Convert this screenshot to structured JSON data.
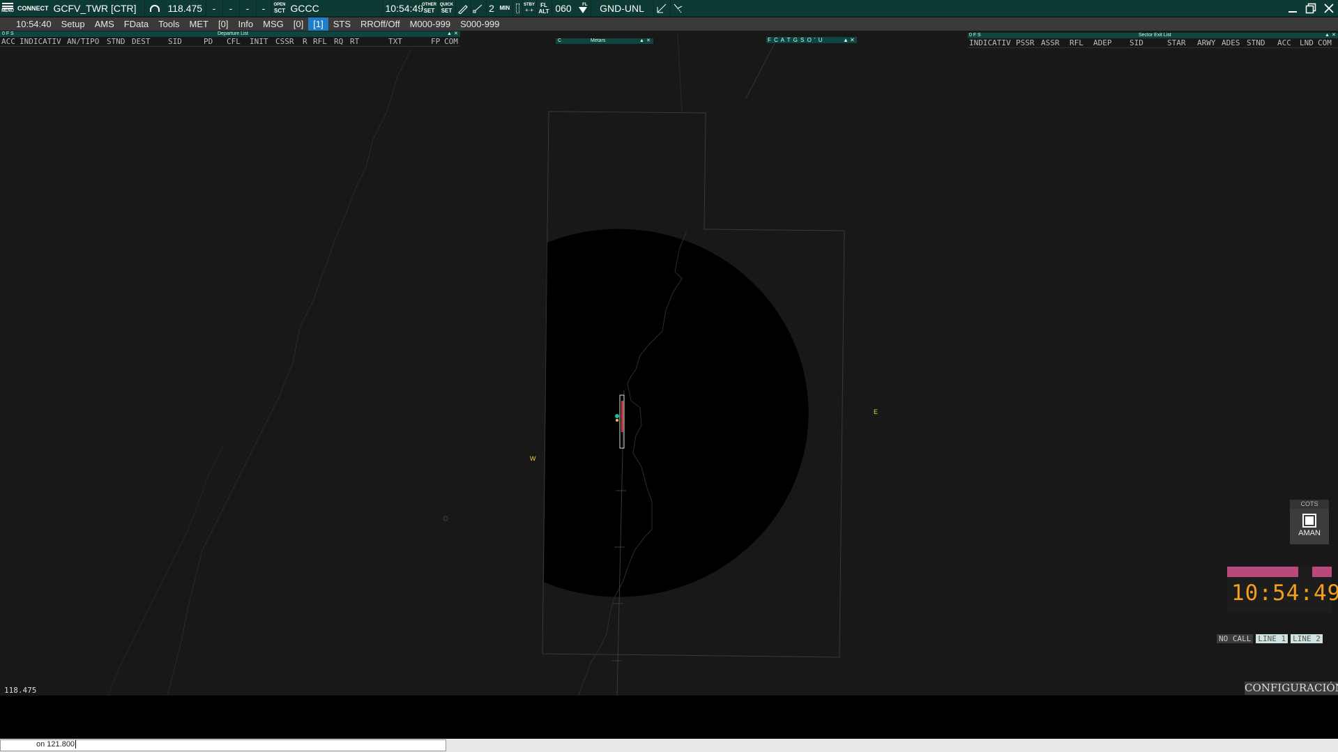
{
  "topbar": {
    "menu": "MENU",
    "connect": "CONNECT",
    "callsign": "GCFV_TWR [CTR]",
    "frequency": "118.475",
    "dash1": "-",
    "dash2": "-",
    "dash3": "-",
    "dash4": "-",
    "open_sct_1": "OPEN",
    "open_sct_2": "SCT",
    "sector": "GCCC",
    "time": "10:54:49",
    "other_set_1": "OTHER",
    "other_set_2": "SET",
    "quick_set_1": "QUICK",
    "quick_set_2": "SET",
    "min_value": "2",
    "min_label": "MIN",
    "stby_1": "STBY",
    "stby_2": "",
    "fl_1": "FL",
    "fl_2": "ALT",
    "alt_value": "060",
    "fl_toggle": "FL",
    "filter": "GND-UNL"
  },
  "menubar": {
    "time": "10:54:40",
    "setup": "Setup",
    "ams": "AMS",
    "fdata": "FData",
    "tools": "Tools",
    "met": "MET",
    "met_count": "[0]",
    "info": "Info",
    "msg": "MSG",
    "msg_count": "[0]",
    "active_count": "[1]",
    "sts": "STS",
    "rroff": "RROff/Off",
    "mode_a": "M000-999",
    "mode_s": "S000-999"
  },
  "departure_list": {
    "flags": "0 F S",
    "title": "Departure List",
    "headers": [
      "ACC",
      "INDICATIV",
      "AN/TIPO",
      "STND",
      "DEST",
      "SID",
      "PD",
      "CFL",
      "INIT",
      "CSSR",
      "R",
      "RFL",
      "RQ",
      "RT",
      "TXT",
      "FP",
      "COM"
    ]
  },
  "metars": {
    "flag": "C",
    "title": "Metars"
  },
  "atis_box": {
    "flags": "F C A T G S O ' U"
  },
  "sector_exit_list": {
    "flags": "0 F S",
    "title": "Sector Exit List",
    "headers": [
      "INDICATIV",
      "PSSR",
      "ASSR",
      "RFL",
      "ADEP",
      "SID",
      "STAR",
      "ARWY",
      "ADES",
      "STND",
      "ACC",
      "LND",
      "COM"
    ]
  },
  "map": {
    "label_w": "W",
    "label_e": "E"
  },
  "cots": {
    "title": "COTS",
    "label": "AMAN"
  },
  "clock": {
    "time": "10:54:49"
  },
  "calls": {
    "no_call": "NO CALL",
    "line1": "LINE 1",
    "line2": "LINE 2"
  },
  "config": {
    "label": "CONFIGURACIÓN"
  },
  "bottom": {
    "frequency": "118.475",
    "command": "on 121.800"
  },
  "colors": {
    "toolbar": "#0e3a34",
    "menubar": "#3a3a3a",
    "active": "#1e7fc8",
    "clock": "#f2a01a",
    "clock_bar": "#b8497a",
    "label_yellow": "#e6d24a"
  }
}
